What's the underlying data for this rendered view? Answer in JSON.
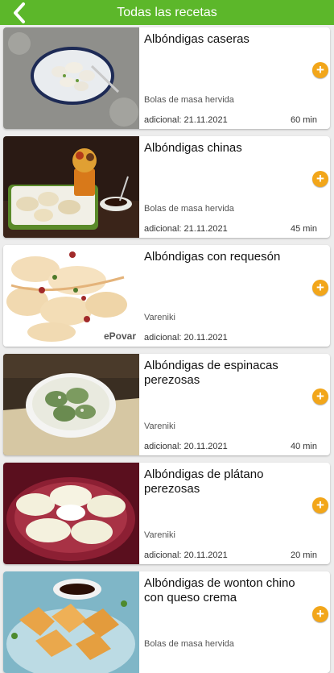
{
  "header": {
    "title": "Todas las recetas",
    "back_icon": "chevron-left-icon"
  },
  "colors": {
    "header": "#5cb72a",
    "add_button": "#f2a61a"
  },
  "recipes": [
    {
      "name": "Albóndigas caseras",
      "category": "Bolas de masa hervida",
      "date": "adicional: 21.11.2021",
      "time": "60 min"
    },
    {
      "name": "Albóndigas chinas",
      "category": "Bolas de masa hervida",
      "date": "adicional: 21.11.2021",
      "time": "45 min"
    },
    {
      "name": "Albóndigas con requesón",
      "category": "Vareniki",
      "date": "adicional: 20.11.2021",
      "time": ""
    },
    {
      "name": "Albóndigas de espinacas perezosas",
      "category": "Vareniki",
      "date": "adicional: 20.11.2021",
      "time": "40 min"
    },
    {
      "name": "Albóndigas de plátano perezosas",
      "category": "Vareniki",
      "date": "adicional: 20.11.2021",
      "time": "20 min"
    },
    {
      "name": "Albóndigas de wonton chino con queso crema",
      "category": "Bolas de masa hervida",
      "date": "",
      "time": ""
    }
  ],
  "watermarks": {
    "epovar": "ePovar"
  }
}
